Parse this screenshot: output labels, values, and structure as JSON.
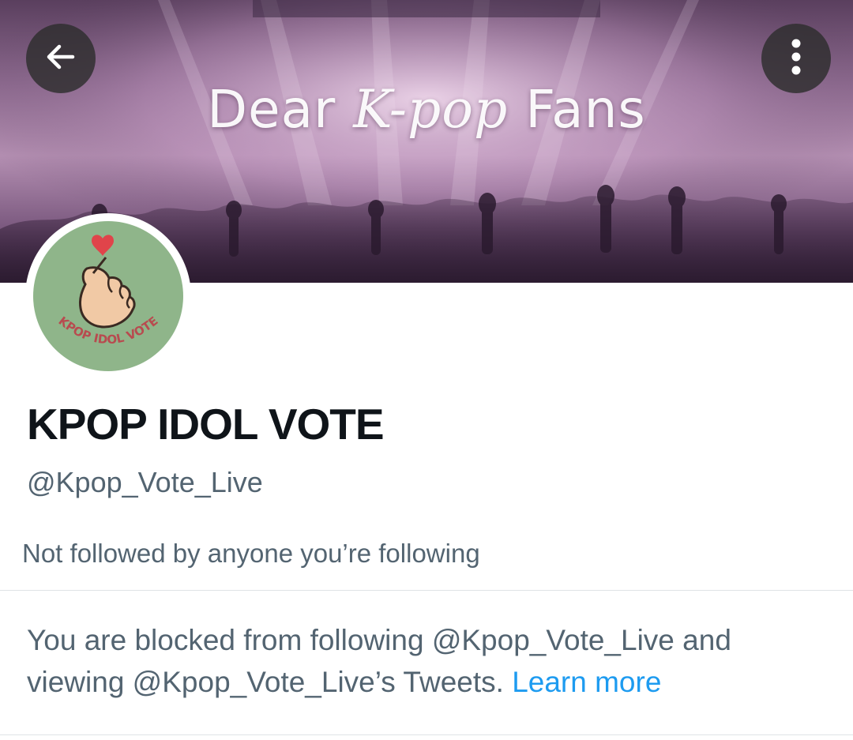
{
  "banner": {
    "title_prefix": "Dear ",
    "title_script": "K-pop",
    "title_suffix": " Fans"
  },
  "nav": {
    "back_icon": "arrow-left-icon",
    "more_icon": "more-vertical-icon"
  },
  "avatar": {
    "text": "KPOP IDOL VOTE",
    "icon": "finger-heart-icon",
    "background": "#8fb58a"
  },
  "profile": {
    "display_name": "KPOP IDOL VOTE",
    "handle": "@Kpop_Vote_Live",
    "follow_note": "Not followed by anyone you’re following"
  },
  "blocked_notice": {
    "text": "You are blocked from following @Kpop_Vote_Live and viewing @Kpop_Vote_Live’s Tweets.",
    "link_label": "Learn more"
  },
  "colors": {
    "text_primary": "#0f1419",
    "text_secondary": "#536471",
    "link": "#1d9bf0"
  }
}
